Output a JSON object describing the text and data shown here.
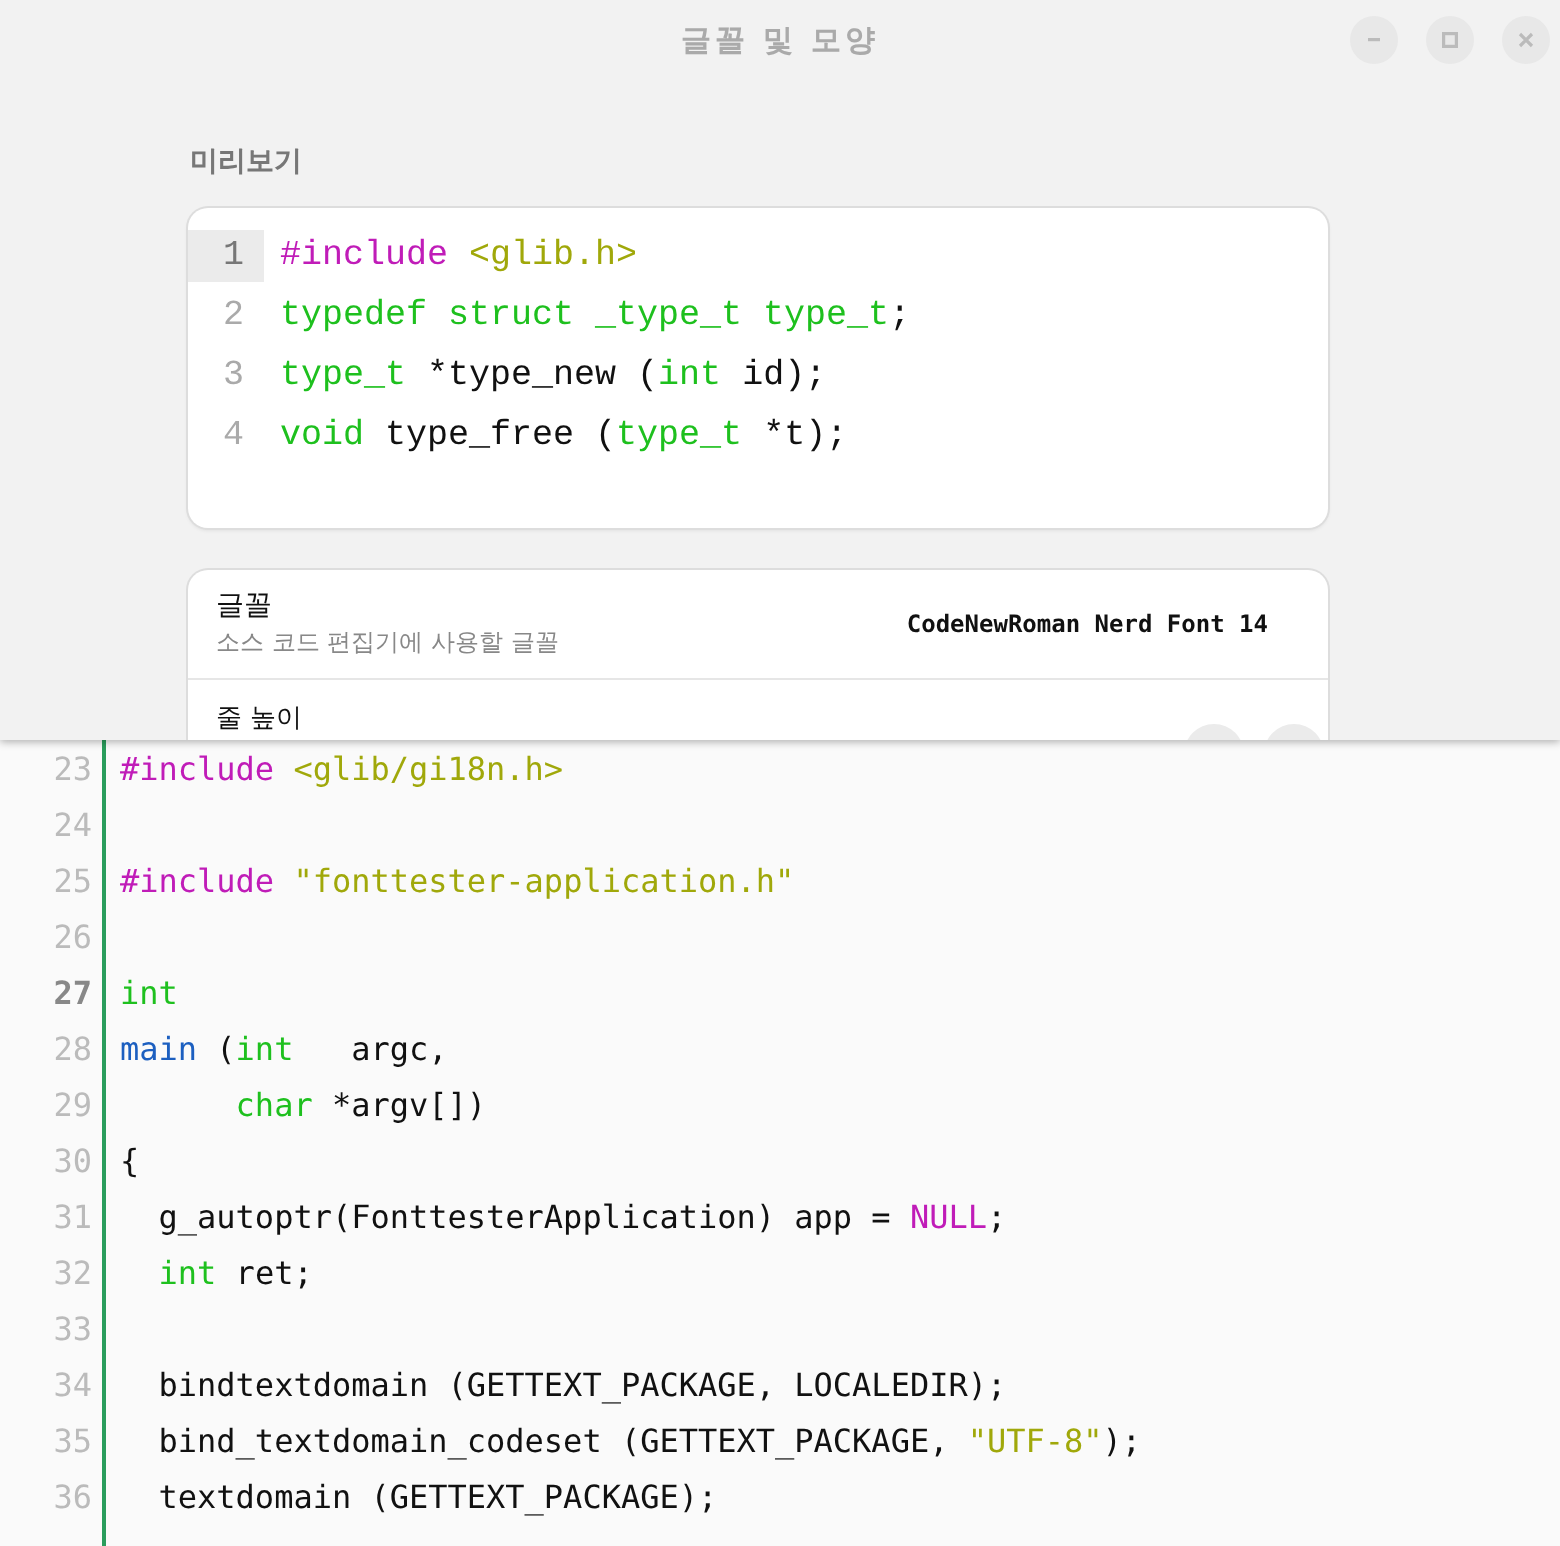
{
  "dialog": {
    "title": "글꼴 및 모양",
    "window_buttons": [
      {
        "kind": "minimize"
      },
      {
        "kind": "maximize"
      },
      {
        "kind": "close"
      }
    ],
    "preview_heading": "미리보기",
    "preview": {
      "lines": [
        {
          "number": "1",
          "current": true,
          "tokens": [
            {
              "t": "#include ",
              "color": "#c01cb8"
            },
            {
              "t": "<glib.h>",
              "color": "#a0a80a"
            }
          ]
        },
        {
          "number": "2",
          "current": false,
          "tokens": [
            {
              "t": "typedef struct _type_t type_t",
              "color": "#1ec01e"
            },
            {
              "t": ";"
            }
          ]
        },
        {
          "number": "3",
          "current": false,
          "tokens": [
            {
              "t": "type_t",
              "color": "#1ec01e"
            },
            {
              "t": " *type_new ("
            },
            {
              "t": "int",
              "color": "#1ec01e"
            },
            {
              "t": " id);"
            }
          ]
        },
        {
          "number": "4",
          "current": false,
          "tokens": [
            {
              "t": "void",
              "color": "#1ec01e"
            },
            {
              "t": " type_free ("
            },
            {
              "t": "type_t",
              "color": "#1ec01e"
            },
            {
              "t": " *t);"
            }
          ]
        }
      ]
    },
    "settings": [
      {
        "title": "글꼴",
        "subtitle": "소스 코드 편집기에 사용할 글꼴",
        "value": "CodeNewRoman Nerd Font 14",
        "kind": "font"
      },
      {
        "title": "줄 높이",
        "kind": "spin"
      }
    ]
  },
  "editor": {
    "lines": [
      {
        "number": "23",
        "current": false,
        "tokens": [
          {
            "t": "#include ",
            "color": "#c01cb8"
          },
          {
            "t": "<glib/gi18n.h>",
            "color": "#a0a80a"
          }
        ]
      },
      {
        "number": "24",
        "current": false
      },
      {
        "number": "25",
        "current": false,
        "tokens": [
          {
            "t": "#include ",
            "color": "#c01cb8"
          },
          {
            "t": "\"fonttester-application.h\"",
            "color": "#a0a80a"
          }
        ]
      },
      {
        "number": "26",
        "current": false
      },
      {
        "number": "27",
        "current": true,
        "tokens": [
          {
            "t": "int",
            "color": "#1ec01e"
          }
        ]
      },
      {
        "number": "28",
        "current": false,
        "tokens": [
          {
            "t": "main",
            "color": "#1c5fc0"
          },
          {
            "t": " ("
          },
          {
            "t": "int",
            "color": "#1ec01e"
          },
          {
            "t": "   argc,"
          }
        ]
      },
      {
        "number": "29",
        "current": false,
        "tokens": [
          {
            "t": "      char",
            "color": "#1ec01e"
          },
          {
            "t": " *argv[])"
          }
        ]
      },
      {
        "number": "30",
        "current": false,
        "tokens": [
          {
            "t": "{"
          }
        ]
      },
      {
        "number": "31",
        "current": false,
        "tokens": [
          {
            "t": "  g_autoptr(FonttesterApplication) app = "
          },
          {
            "t": "NULL",
            "color": "#c01cb8"
          },
          {
            "t": ";"
          }
        ]
      },
      {
        "number": "32",
        "current": false,
        "tokens": [
          {
            "t": "  int",
            "color": "#1ec01e"
          },
          {
            "t": " ret;"
          }
        ]
      },
      {
        "number": "33",
        "current": false
      },
      {
        "number": "34",
        "current": false,
        "tokens": [
          {
            "t": "  bindtextdomain (GETTEXT_PACKAGE, LOCALEDIR);"
          }
        ]
      },
      {
        "number": "35",
        "current": false,
        "tokens": [
          {
            "t": "  bind_textdomain_codeset (GETTEXT_PACKAGE, "
          },
          {
            "t": "\"UTF-8\"",
            "color": "#a0a80a"
          },
          {
            "t": ");"
          }
        ]
      },
      {
        "number": "36",
        "current": false,
        "tokens": [
          {
            "t": "  textdomain (GETTEXT_PACKAGE);"
          }
        ]
      }
    ]
  }
}
